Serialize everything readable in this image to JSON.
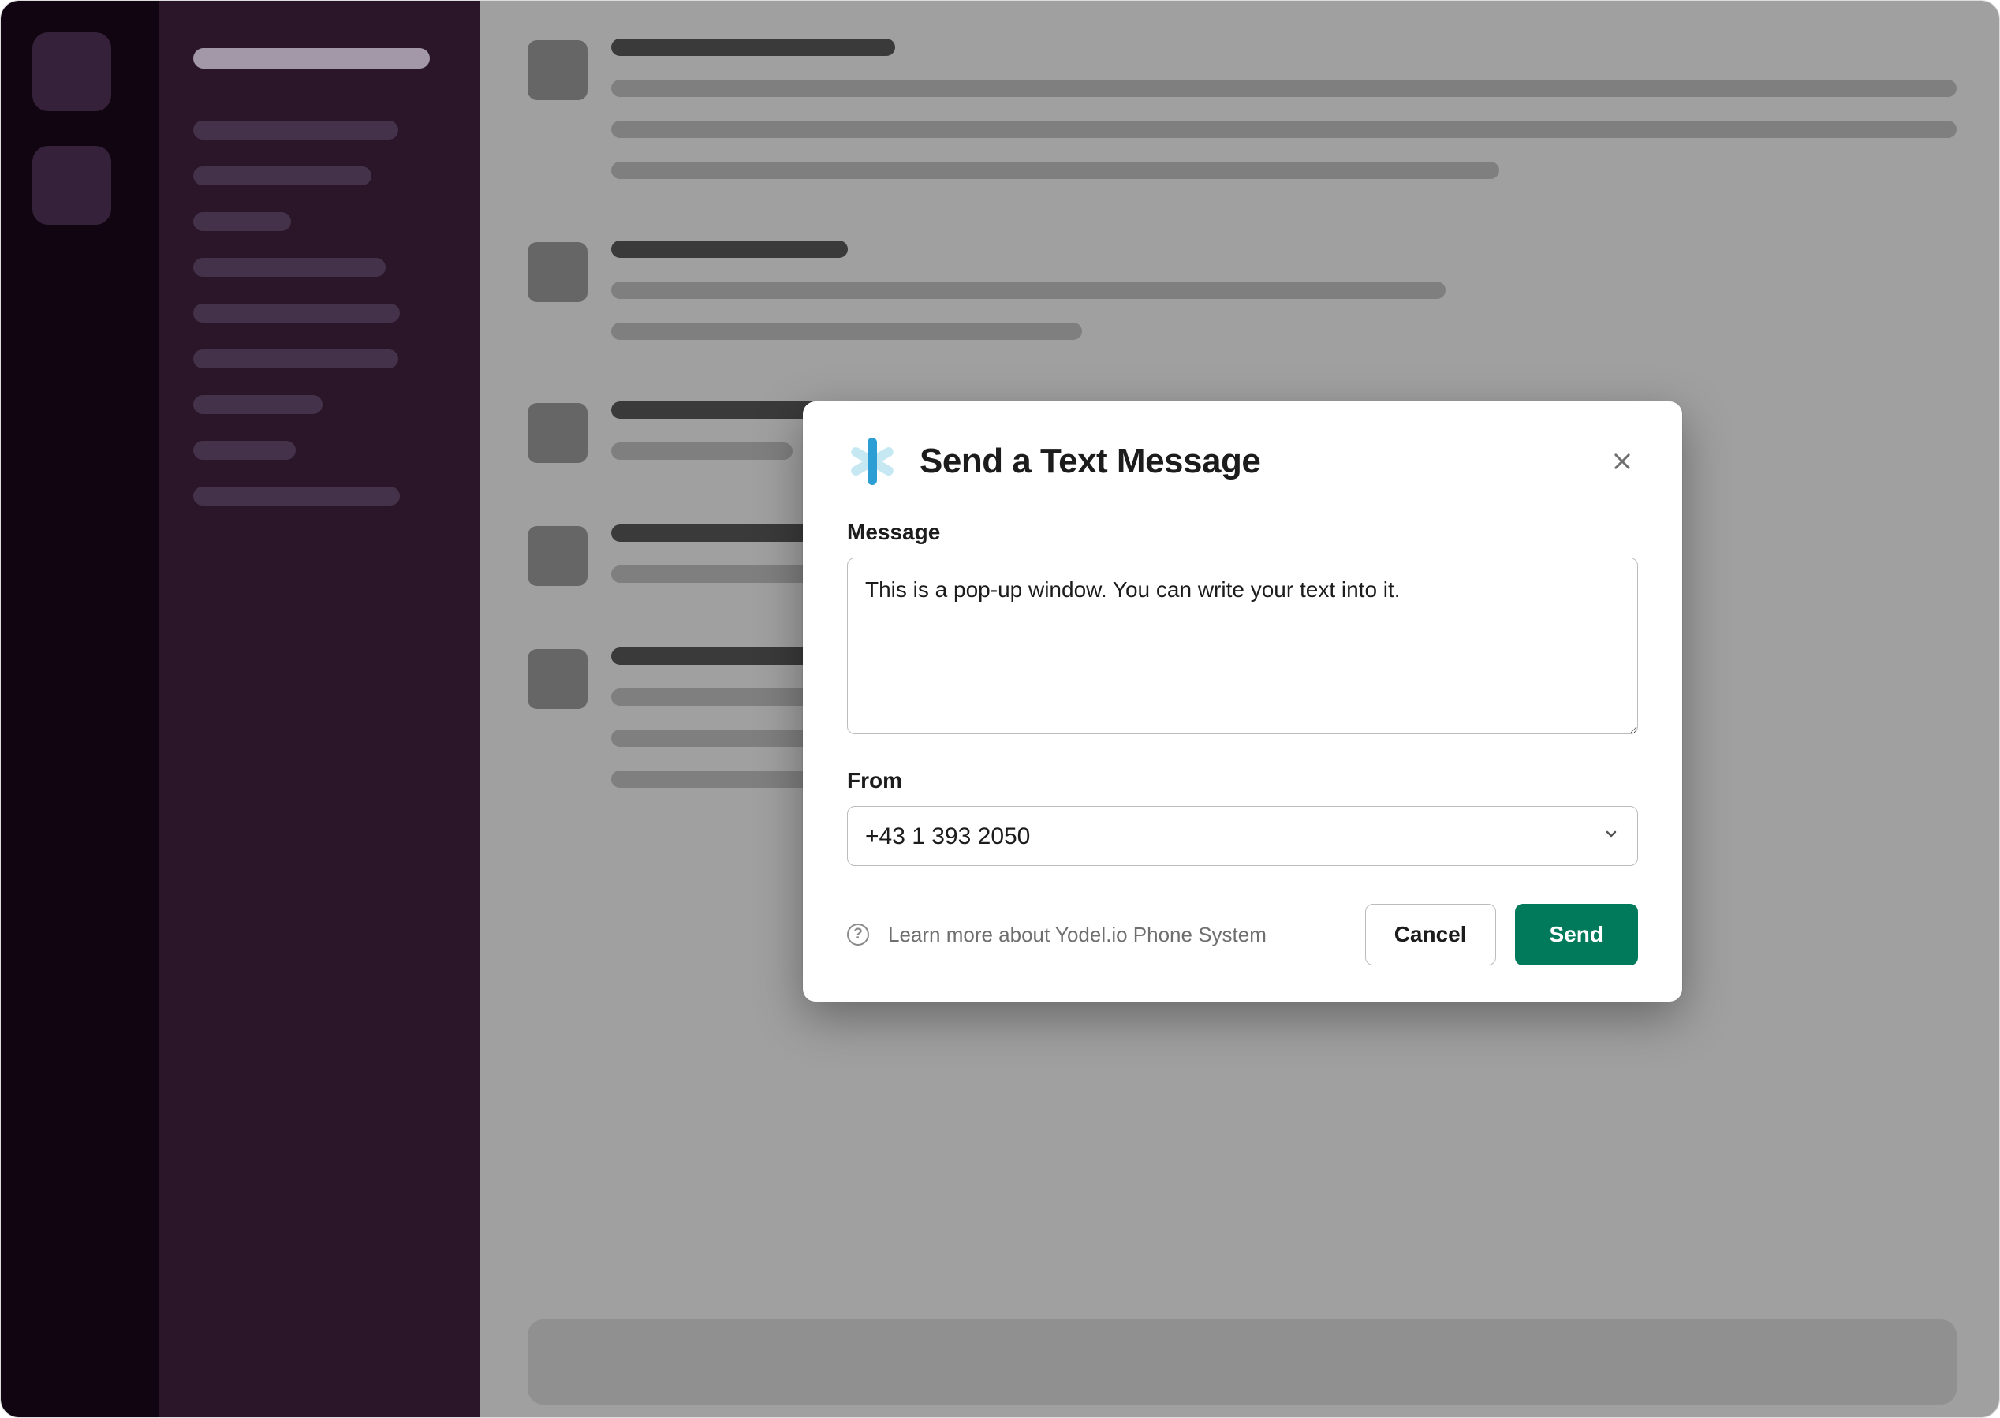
{
  "modal": {
    "title": "Send a Text Message",
    "message_label": "Message",
    "message_value": "This is a pop-up window. You can write your text into it.",
    "from_label": "From",
    "from_value": "+43 1 393 2050",
    "learn_text": "Learn more about Yodel.io Phone System",
    "cancel_label": "Cancel",
    "send_label": "Send"
  },
  "colors": {
    "send_bg": "#007a5a",
    "rail_bg": "#100510",
    "sidebar_bg": "#2a1529"
  }
}
